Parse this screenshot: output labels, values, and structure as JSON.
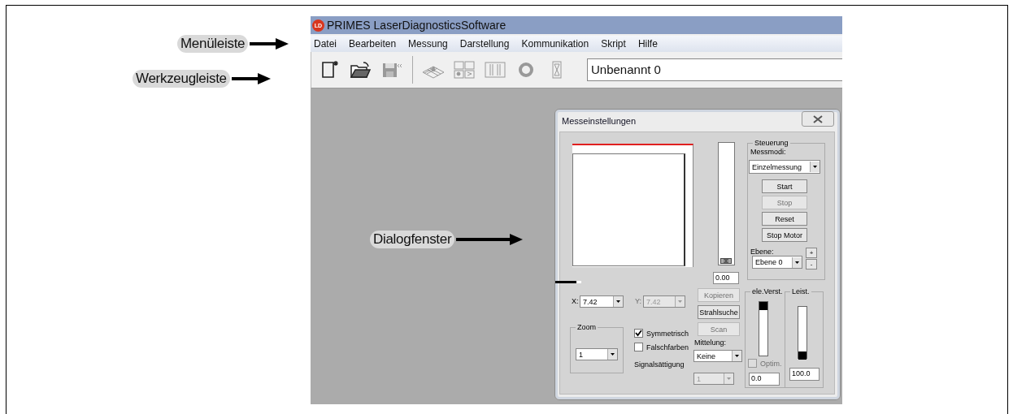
{
  "callouts": [
    {
      "label": "Menüleiste",
      "kind": "menu"
    },
    {
      "label": "Werkzeugleiste",
      "kind": "toolbar"
    },
    {
      "label": "Dialogfenster",
      "kind": "dialog"
    }
  ],
  "window": {
    "logo": "LD",
    "title": "PRIMES LaserDiagnosticsSoftware"
  },
  "menu": [
    "Datei",
    "Bearbeiten",
    "Messung",
    "Darstellung",
    "Kommunikation",
    "Skript",
    "Hilfe"
  ],
  "toolbar": {
    "tools": [
      {
        "kind": "new",
        "disabled": false
      },
      {
        "kind": "open",
        "disabled": false
      },
      {
        "kind": "save",
        "disabled": true
      },
      {
        "kind": "beam",
        "disabled": true
      },
      {
        "kind": "layout",
        "disabled": true
      },
      {
        "kind": "columns",
        "disabled": true
      },
      {
        "kind": "ring",
        "disabled": true
      },
      {
        "kind": "hourglass",
        "disabled": true
      }
    ],
    "document": "Unbenannt 0"
  },
  "dialog": {
    "title": "Messeinstellungen",
    "z_value": "0.00",
    "control": {
      "title": "Steuerung",
      "mode_label": "Messmodi:",
      "mode": "Einzelmessung",
      "buttons": [
        {
          "label": "Start",
          "disabled": false
        },
        {
          "label": "Stop",
          "disabled": true
        },
        {
          "label": "Reset",
          "disabled": false
        },
        {
          "label": "Stop Motor",
          "disabled": false
        }
      ],
      "plane_label": "Ebene:",
      "plane": "Ebene 0",
      "plane_buttons": [
        "+",
        "-"
      ]
    },
    "x": {
      "label": "X:",
      "value": "7.42",
      "disabled": false
    },
    "y": {
      "label": "Y:",
      "value": "7.42",
      "disabled": true
    },
    "actions": [
      {
        "label": "Kopieren",
        "disabled": true
      },
      {
        "label": "Strahlsuche",
        "disabled": false
      },
      {
        "label": "Scan",
        "disabled": true
      }
    ],
    "zoom": {
      "title": "Zoom",
      "value": "1"
    },
    "checks": [
      {
        "label": "Symmetrisch",
        "checked": true
      },
      {
        "label": "Falschfarben",
        "checked": false
      }
    ],
    "saturation": {
      "label": "Signalsättigung",
      "value": "1",
      "disabled": true
    },
    "averaging": {
      "label": "Mittelung:",
      "value": "Keine"
    },
    "gain": {
      "title": "ele.Verst.",
      "level": 1,
      "optim": {
        "label": "Optim.",
        "checked": false,
        "disabled": true
      },
      "value": "0.0"
    },
    "power": {
      "title": "Leist.",
      "level": 0,
      "value": "100.0"
    }
  }
}
